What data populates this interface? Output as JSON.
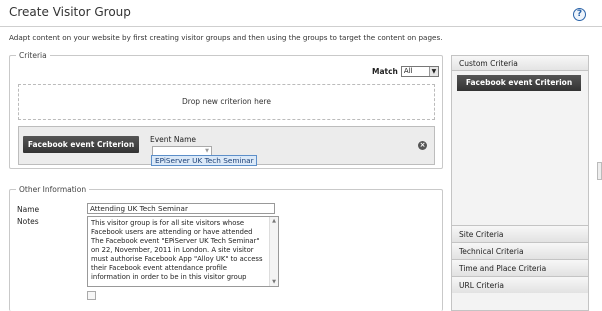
{
  "page": {
    "title": "Create Visitor Group",
    "help_icon": "help-icon",
    "help_glyph": "?",
    "intro": "Adapt content on your website by first creating visitor groups and then using the groups to target the content on pages."
  },
  "criteria": {
    "legend": "Criteria",
    "match_label": "Match",
    "match_value": "All",
    "drop_zone_text": "Drop new criterion here",
    "criterion": {
      "name": "Facebook event Criterion",
      "field_label": "Event Name",
      "field_value": "",
      "suggestion": "EPiServer UK Tech Seminar",
      "remove_glyph": "×"
    }
  },
  "other_information": {
    "legend": "Other Information",
    "name_label": "Name",
    "name_value": "Attending UK Tech Seminar",
    "notes_label": "Notes",
    "notes_value": "This visitor group is for all site visitors whose Facebook users are attending or have attended The Facebook event \"EPiServer UK Tech Seminar\" on 22, November, 2011 in London. A site visitor must authorise Facebook App \"Alloy UK\" to access their Facebook event attendance profile information in order to be in this visitor group"
  },
  "sidebar": {
    "header": "Custom Criteria",
    "custom_item": "Facebook event Criterion",
    "items": [
      {
        "label": "Site Criteria"
      },
      {
        "label": "Technical Criteria"
      },
      {
        "label": "Time and Place Criteria"
      },
      {
        "label": "URL Criteria"
      }
    ]
  },
  "colors": {
    "badge_bg": "#3f3f3f",
    "suggestion_bg": "#dbe9f8",
    "accent": "#2a63a8"
  }
}
